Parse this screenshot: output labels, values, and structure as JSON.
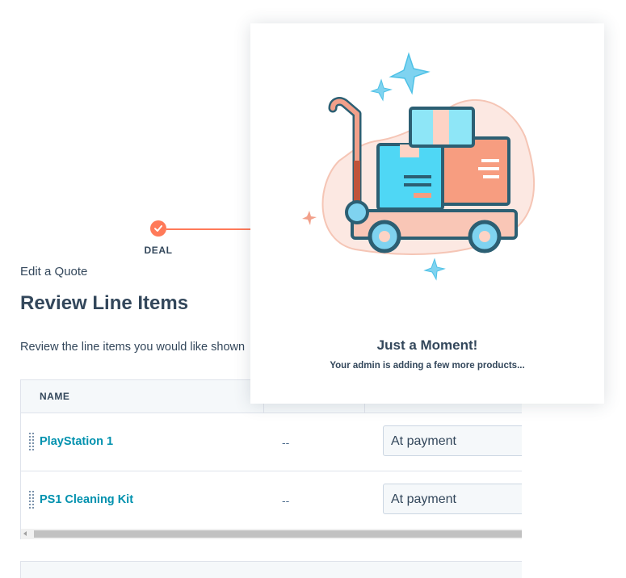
{
  "stepper": {
    "current_step_label": "DEAL"
  },
  "header": {
    "breadcrumb": "Edit a Quote",
    "title": "Review Line Items",
    "description": "Review the line items you would like shown"
  },
  "table": {
    "columns": [
      "NAME",
      "",
      ""
    ],
    "rows": [
      {
        "name": "PlayStation 1",
        "dash": "--",
        "billing": "At payment"
      },
      {
        "name": "PS1 Cleaning Kit",
        "dash": "--",
        "billing": "At payment"
      }
    ]
  },
  "popup": {
    "title": "Just a Moment!",
    "subtitle": "Your admin is adding a few more products..."
  },
  "colors": {
    "accent": "#ff7a59",
    "link": "#0091ae",
    "text": "#33475b"
  }
}
